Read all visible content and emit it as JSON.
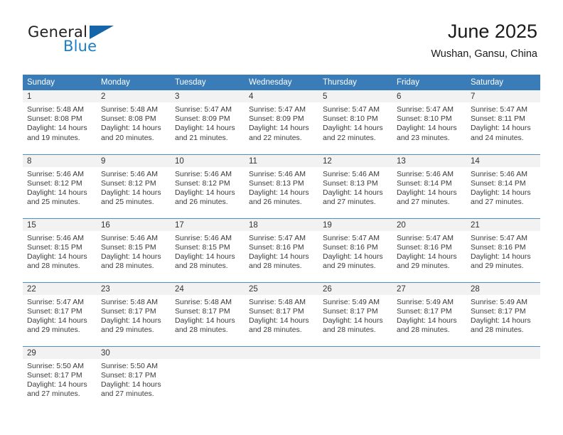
{
  "brand": {
    "name_part1": "General",
    "name_part2": "Blue",
    "flag_icon": "triangle-flag-icon",
    "accent_color": "#1c7fc4",
    "flag_color": "#1565a8"
  },
  "header": {
    "month_title": "June 2025",
    "location": "Wushan, Gansu, China"
  },
  "calendar": {
    "header_bg": "#3a7cb8",
    "daynum_bg": "#f2f2f2",
    "grid_line_color": "#4f8fc4",
    "weekday_headers": [
      "Sunday",
      "Monday",
      "Tuesday",
      "Wednesday",
      "Thursday",
      "Friday",
      "Saturday"
    ],
    "labels": {
      "sunrise": "Sunrise:",
      "sunset": "Sunset:",
      "daylight": "Daylight:"
    },
    "weeks": [
      [
        {
          "day": "1",
          "sunrise": "Sunrise: 5:48 AM",
          "sunset": "Sunset: 8:08 PM",
          "daylight_line1": "Daylight: 14 hours",
          "daylight_line2": "and 19 minutes."
        },
        {
          "day": "2",
          "sunrise": "Sunrise: 5:48 AM",
          "sunset": "Sunset: 8:08 PM",
          "daylight_line1": "Daylight: 14 hours",
          "daylight_line2": "and 20 minutes."
        },
        {
          "day": "3",
          "sunrise": "Sunrise: 5:47 AM",
          "sunset": "Sunset: 8:09 PM",
          "daylight_line1": "Daylight: 14 hours",
          "daylight_line2": "and 21 minutes."
        },
        {
          "day": "4",
          "sunrise": "Sunrise: 5:47 AM",
          "sunset": "Sunset: 8:09 PM",
          "daylight_line1": "Daylight: 14 hours",
          "daylight_line2": "and 22 minutes."
        },
        {
          "day": "5",
          "sunrise": "Sunrise: 5:47 AM",
          "sunset": "Sunset: 8:10 PM",
          "daylight_line1": "Daylight: 14 hours",
          "daylight_line2": "and 22 minutes."
        },
        {
          "day": "6",
          "sunrise": "Sunrise: 5:47 AM",
          "sunset": "Sunset: 8:10 PM",
          "daylight_line1": "Daylight: 14 hours",
          "daylight_line2": "and 23 minutes."
        },
        {
          "day": "7",
          "sunrise": "Sunrise: 5:47 AM",
          "sunset": "Sunset: 8:11 PM",
          "daylight_line1": "Daylight: 14 hours",
          "daylight_line2": "and 24 minutes."
        }
      ],
      [
        {
          "day": "8",
          "sunrise": "Sunrise: 5:46 AM",
          "sunset": "Sunset: 8:12 PM",
          "daylight_line1": "Daylight: 14 hours",
          "daylight_line2": "and 25 minutes."
        },
        {
          "day": "9",
          "sunrise": "Sunrise: 5:46 AM",
          "sunset": "Sunset: 8:12 PM",
          "daylight_line1": "Daylight: 14 hours",
          "daylight_line2": "and 25 minutes."
        },
        {
          "day": "10",
          "sunrise": "Sunrise: 5:46 AM",
          "sunset": "Sunset: 8:12 PM",
          "daylight_line1": "Daylight: 14 hours",
          "daylight_line2": "and 26 minutes."
        },
        {
          "day": "11",
          "sunrise": "Sunrise: 5:46 AM",
          "sunset": "Sunset: 8:13 PM",
          "daylight_line1": "Daylight: 14 hours",
          "daylight_line2": "and 26 minutes."
        },
        {
          "day": "12",
          "sunrise": "Sunrise: 5:46 AM",
          "sunset": "Sunset: 8:13 PM",
          "daylight_line1": "Daylight: 14 hours",
          "daylight_line2": "and 27 minutes."
        },
        {
          "day": "13",
          "sunrise": "Sunrise: 5:46 AM",
          "sunset": "Sunset: 8:14 PM",
          "daylight_line1": "Daylight: 14 hours",
          "daylight_line2": "and 27 minutes."
        },
        {
          "day": "14",
          "sunrise": "Sunrise: 5:46 AM",
          "sunset": "Sunset: 8:14 PM",
          "daylight_line1": "Daylight: 14 hours",
          "daylight_line2": "and 27 minutes."
        }
      ],
      [
        {
          "day": "15",
          "sunrise": "Sunrise: 5:46 AM",
          "sunset": "Sunset: 8:15 PM",
          "daylight_line1": "Daylight: 14 hours",
          "daylight_line2": "and 28 minutes."
        },
        {
          "day": "16",
          "sunrise": "Sunrise: 5:46 AM",
          "sunset": "Sunset: 8:15 PM",
          "daylight_line1": "Daylight: 14 hours",
          "daylight_line2": "and 28 minutes."
        },
        {
          "day": "17",
          "sunrise": "Sunrise: 5:46 AM",
          "sunset": "Sunset: 8:15 PM",
          "daylight_line1": "Daylight: 14 hours",
          "daylight_line2": "and 28 minutes."
        },
        {
          "day": "18",
          "sunrise": "Sunrise: 5:47 AM",
          "sunset": "Sunset: 8:16 PM",
          "daylight_line1": "Daylight: 14 hours",
          "daylight_line2": "and 28 minutes."
        },
        {
          "day": "19",
          "sunrise": "Sunrise: 5:47 AM",
          "sunset": "Sunset: 8:16 PM",
          "daylight_line1": "Daylight: 14 hours",
          "daylight_line2": "and 29 minutes."
        },
        {
          "day": "20",
          "sunrise": "Sunrise: 5:47 AM",
          "sunset": "Sunset: 8:16 PM",
          "daylight_line1": "Daylight: 14 hours",
          "daylight_line2": "and 29 minutes."
        },
        {
          "day": "21",
          "sunrise": "Sunrise: 5:47 AM",
          "sunset": "Sunset: 8:16 PM",
          "daylight_line1": "Daylight: 14 hours",
          "daylight_line2": "and 29 minutes."
        }
      ],
      [
        {
          "day": "22",
          "sunrise": "Sunrise: 5:47 AM",
          "sunset": "Sunset: 8:17 PM",
          "daylight_line1": "Daylight: 14 hours",
          "daylight_line2": "and 29 minutes."
        },
        {
          "day": "23",
          "sunrise": "Sunrise: 5:48 AM",
          "sunset": "Sunset: 8:17 PM",
          "daylight_line1": "Daylight: 14 hours",
          "daylight_line2": "and 29 minutes."
        },
        {
          "day": "24",
          "sunrise": "Sunrise: 5:48 AM",
          "sunset": "Sunset: 8:17 PM",
          "daylight_line1": "Daylight: 14 hours",
          "daylight_line2": "and 28 minutes."
        },
        {
          "day": "25",
          "sunrise": "Sunrise: 5:48 AM",
          "sunset": "Sunset: 8:17 PM",
          "daylight_line1": "Daylight: 14 hours",
          "daylight_line2": "and 28 minutes."
        },
        {
          "day": "26",
          "sunrise": "Sunrise: 5:49 AM",
          "sunset": "Sunset: 8:17 PM",
          "daylight_line1": "Daylight: 14 hours",
          "daylight_line2": "and 28 minutes."
        },
        {
          "day": "27",
          "sunrise": "Sunrise: 5:49 AM",
          "sunset": "Sunset: 8:17 PM",
          "daylight_line1": "Daylight: 14 hours",
          "daylight_line2": "and 28 minutes."
        },
        {
          "day": "28",
          "sunrise": "Sunrise: 5:49 AM",
          "sunset": "Sunset: 8:17 PM",
          "daylight_line1": "Daylight: 14 hours",
          "daylight_line2": "and 28 minutes."
        }
      ],
      [
        {
          "day": "29",
          "sunrise": "Sunrise: 5:50 AM",
          "sunset": "Sunset: 8:17 PM",
          "daylight_line1": "Daylight: 14 hours",
          "daylight_line2": "and 27 minutes."
        },
        {
          "day": "30",
          "sunrise": "Sunrise: 5:50 AM",
          "sunset": "Sunset: 8:17 PM",
          "daylight_line1": "Daylight: 14 hours",
          "daylight_line2": "and 27 minutes."
        },
        {
          "day": "",
          "sunrise": "",
          "sunset": "",
          "daylight_line1": "",
          "daylight_line2": ""
        },
        {
          "day": "",
          "sunrise": "",
          "sunset": "",
          "daylight_line1": "",
          "daylight_line2": ""
        },
        {
          "day": "",
          "sunrise": "",
          "sunset": "",
          "daylight_line1": "",
          "daylight_line2": ""
        },
        {
          "day": "",
          "sunrise": "",
          "sunset": "",
          "daylight_line1": "",
          "daylight_line2": ""
        },
        {
          "day": "",
          "sunrise": "",
          "sunset": "",
          "daylight_line1": "",
          "daylight_line2": ""
        }
      ]
    ]
  }
}
